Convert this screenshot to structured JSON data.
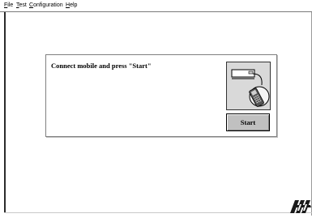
{
  "menu": {
    "file": {
      "hot": "F",
      "rest": "ile"
    },
    "test": {
      "hot": "T",
      "rest": "est"
    },
    "configuration": {
      "hot": "C",
      "rest": "onfiguration"
    },
    "help": {
      "hot": "H",
      "rest": "elp"
    }
  },
  "panel": {
    "prompt": "Connect mobile and press \"Start\"",
    "start_label": "Start"
  },
  "icons": {
    "picture": "phone-connect-illustration",
    "logo": "brand-logo"
  }
}
